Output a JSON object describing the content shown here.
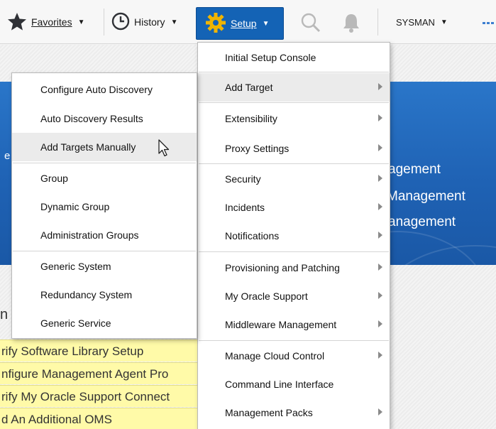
{
  "toolbar": {
    "favorites_label": "Favorites",
    "history_label": "History",
    "setup_label": "Setup",
    "user_label": "SYSMAN"
  },
  "setup_menu": {
    "items": [
      {
        "label": "Initial Setup Console",
        "submenu": false
      },
      {
        "label": "Add Target",
        "submenu": true
      },
      {
        "label": "Extensibility",
        "submenu": true
      },
      {
        "label": "Proxy Settings",
        "submenu": true
      },
      {
        "label": "Security",
        "submenu": true
      },
      {
        "label": "Incidents",
        "submenu": true
      },
      {
        "label": "Notifications",
        "submenu": true
      },
      {
        "label": "Provisioning and Patching",
        "submenu": true
      },
      {
        "label": "My Oracle Support",
        "submenu": true
      },
      {
        "label": "Middleware Management",
        "submenu": true
      },
      {
        "label": "Manage Cloud Control",
        "submenu": true
      },
      {
        "label": "Command Line Interface",
        "submenu": false
      },
      {
        "label": "Management Packs",
        "submenu": true
      }
    ]
  },
  "add_target_submenu": {
    "items": [
      {
        "label": "Configure Auto Discovery"
      },
      {
        "label": "Auto Discovery Results"
      },
      {
        "label": "Add Targets Manually"
      },
      {
        "label": "Group"
      },
      {
        "label": "Dynamic Group"
      },
      {
        "label": "Administration Groups"
      },
      {
        "label": "Generic System"
      },
      {
        "label": "Redundancy System"
      },
      {
        "label": "Generic Service"
      }
    ]
  },
  "banner": {
    "line1": "agement",
    "line2": "Management",
    "line3": "anagement",
    "left_fragment": "e"
  },
  "background": {
    "heading_fragment": "n",
    "tasks": [
      "rify Software Library Setup",
      "nfigure Management Agent Pro",
      "rify My Oracle Support Connect",
      "d An Additional OMS"
    ]
  },
  "colors": {
    "setup_button": "#1463b5",
    "banner": "#1f62b4",
    "task_highlight": "#fffaa8",
    "menu_hover": "#ebebeb"
  },
  "icons": [
    "star-icon",
    "clock-icon",
    "gear-icon",
    "search-icon",
    "bell-icon",
    "pointer-cursor-icon"
  ]
}
